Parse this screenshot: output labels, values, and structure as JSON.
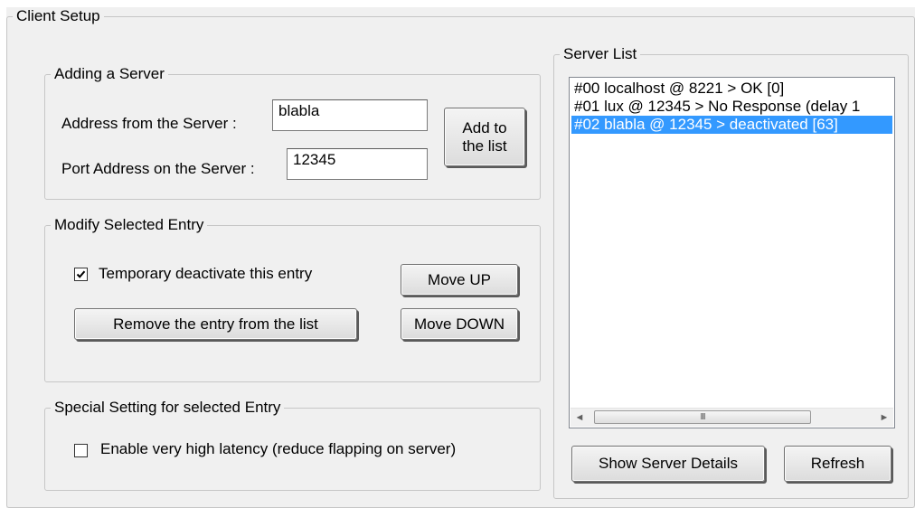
{
  "client_setup": {
    "title": "Client Setup"
  },
  "adding_server": {
    "title": "Adding a Server",
    "address_label": "Address from the Server :",
    "address_value": "blabla",
    "port_label": "Port Address on the Server :",
    "port_value": "12345",
    "add_button_line1": "Add to",
    "add_button_line2": "the list"
  },
  "modify_entry": {
    "title": "Modify Selected Entry",
    "deactivate_label": "Temporary deactivate this entry",
    "deactivate_checked": true,
    "remove_button": "Remove the entry from the list",
    "move_up_button": "Move UP",
    "move_down_button": "Move DOWN"
  },
  "special_setting": {
    "title": "Special Setting for selected Entry",
    "high_latency_label": "Enable very high latency (reduce flapping on server)",
    "high_latency_checked": false
  },
  "server_list": {
    "title": "Server List",
    "items": [
      {
        "text": "#00 localhost @ 8221 > OK [0]",
        "selected": false
      },
      {
        "text": "#01 lux @ 12345 > No Response (delay 1",
        "selected": false
      },
      {
        "text": "#02 blabla @ 12345 > deactivated [63]",
        "selected": true
      }
    ],
    "scrollbar": {
      "left_arrow": "◄",
      "right_arrow": "►",
      "thumb_grip": "III"
    },
    "details_button": "Show Server Details",
    "refresh_button": "Refresh"
  },
  "colors": {
    "selection": "#3399ff",
    "panel": "#f0f0f0",
    "group_border": "#c6c6c6"
  },
  "icons": {
    "checkmark": "check-icon"
  }
}
